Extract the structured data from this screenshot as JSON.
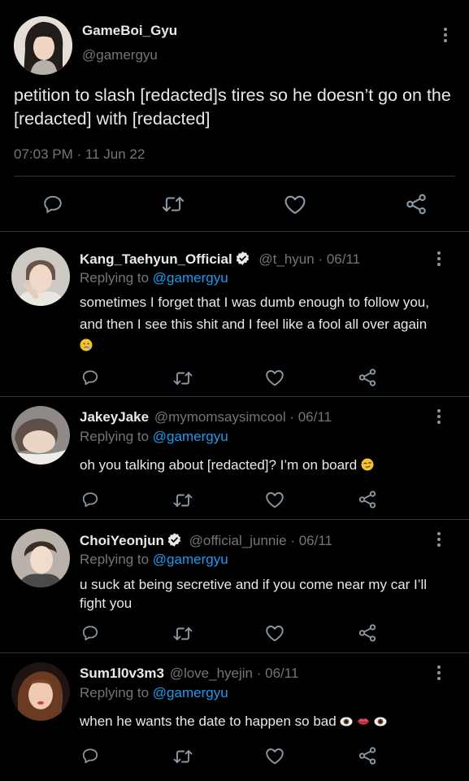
{
  "main_tweet": {
    "display_name": "GameBoi_Gyu",
    "handle": "@gamergyu",
    "text": "petition to slash [redacted]s tires so he doesn’t go on the [redacted] with [redacted]",
    "time": "07:03 PM",
    "separator": "·",
    "date": "11 Jun 22",
    "avatar_icon": "profile-photo"
  },
  "replies": [
    {
      "display_name": "Kang_Taehyun_Official",
      "verified": true,
      "handle": "@t_hyun",
      "date": "· 06/11",
      "replying_prefix": "Replying to",
      "replying_to": "@gamergyu",
      "text": "sometimes I forget that I was dumb enough to follow you, and then I see this shit and I feel like a fool all over again",
      "emoji_icon": "crying-face-emoji"
    },
    {
      "display_name": "JakeyJake",
      "verified": false,
      "handle": "@mymomsaysimcool",
      "date": "· 06/11",
      "replying_prefix": "Replying to",
      "replying_to": "@gamergyu",
      "text": "oh you talking about [redacted]? I’m on board",
      "emoji_icon": "smirking-face-emoji"
    },
    {
      "display_name": "ChoiYeonjun",
      "verified": true,
      "handle": "@official_junnie",
      "date": "· 06/11",
      "replying_prefix": "Replying to",
      "replying_to": "@gamergyu",
      "text": "u suck at being secretive and if you come near my car I’ll fight you"
    },
    {
      "display_name": "Sum1l0v3m3",
      "verified": false,
      "handle": "@love_hyejin",
      "date": "· 06/11",
      "replying_prefix": "Replying to",
      "replying_to": "@gamergyu",
      "text": "when he wants the date to happen so bad",
      "emoji_icons": [
        "eye-emoji",
        "lips-emoji",
        "eye-emoji"
      ]
    }
  ],
  "colors": {
    "background": "#000000",
    "text": "#e7e9ea",
    "muted": "#71767b",
    "accent": "#1d9bf0",
    "divider": "#2f3336"
  }
}
